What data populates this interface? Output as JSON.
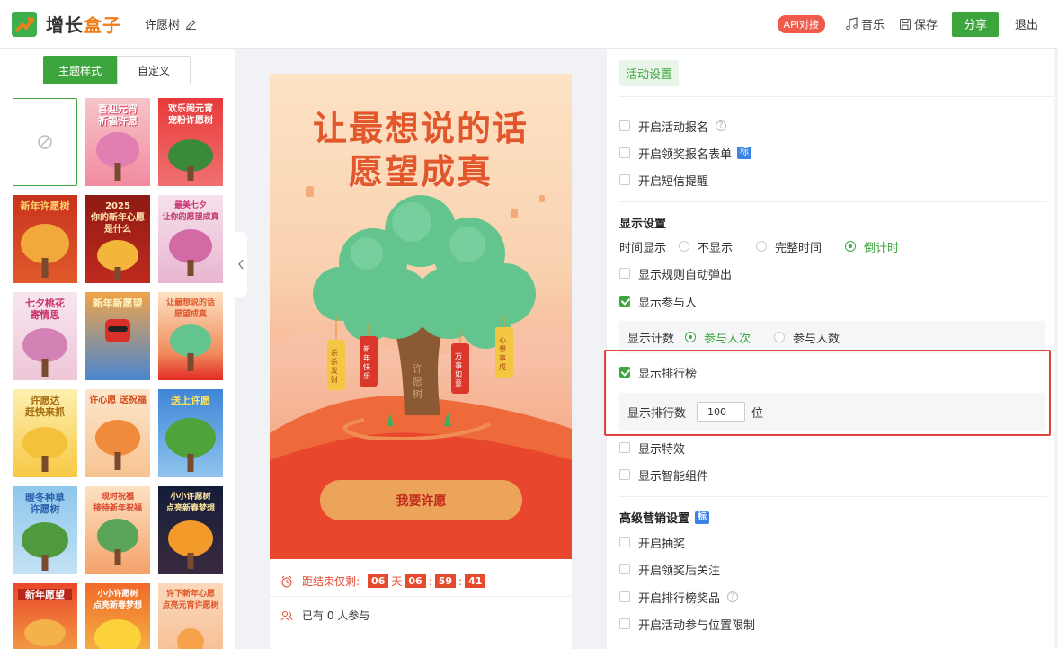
{
  "header": {
    "logo_text_part1": "增长",
    "logo_text_part2": "盒子",
    "doc_title": "许愿树",
    "api_badge": "API对接",
    "music_label": "音乐",
    "save_label": "保存",
    "share_label": "分享",
    "exit_label": "退出"
  },
  "left": {
    "tabs": [
      "主题样式",
      "自定义"
    ],
    "thumbnails": [
      {
        "caption": "",
        "name": "theme-thumb-none"
      },
      {
        "caption": "喜迎元宵\n祈福许愿",
        "name": "theme-thumb-lantern"
      },
      {
        "caption": "欢乐闹元宵\n宠粉许愿树",
        "name": "theme-thumb-party"
      },
      {
        "caption": "新年许愿树",
        "name": "theme-thumb-newyear"
      },
      {
        "caption": "2025\n你的新年心愿\n是什么",
        "name": "theme-thumb-2025"
      },
      {
        "caption": "最美七夕\n让你的愿望成真",
        "name": "theme-thumb-qixi"
      },
      {
        "caption": "七夕桃花\n寄情思",
        "name": "theme-thumb-peach"
      },
      {
        "caption": "新年新愿望",
        "name": "theme-thumb-snake"
      },
      {
        "caption": "让最想说的话\n愿望成真",
        "name": "theme-thumb-current"
      },
      {
        "caption": "许愿达\n赶快来抓",
        "name": "theme-thumb-yellow"
      },
      {
        "caption": "许心愿 送祝福",
        "name": "theme-thumb-orange"
      },
      {
        "caption": "送上许愿",
        "name": "theme-thumb-blue"
      },
      {
        "caption": "暖冬种草\n许愿树",
        "name": "theme-thumb-winter"
      },
      {
        "caption": "现时祝福\n接待新年祝福",
        "name": "theme-thumb-coin"
      },
      {
        "caption": "小小许愿树\n点亮新春梦想",
        "name": "theme-thumb-dark"
      },
      {
        "caption": "新年愿望",
        "name": "theme-thumb-door"
      },
      {
        "caption": "小小许愿树\n点亮新春梦想",
        "name": "theme-thumb-gold"
      },
      {
        "caption": "许下新年心愿\n点亮元宵许愿树",
        "name": "theme-thumb-lamp"
      }
    ]
  },
  "phone": {
    "title_line1": "让最想说的话",
    "title_line2": "愿望成真",
    "trunk_text": "许愿树",
    "tag1": "杀杀发财",
    "tag2": "新年快乐",
    "tag3": "万事如意",
    "tag4": "心想事成",
    "wish_button": "我要许愿",
    "countdown_prefix": "距结束仅剩:",
    "countdown_days": "06",
    "countdown_day_unit": "天",
    "countdown_hours": "06",
    "countdown_minutes": "59",
    "countdown_seconds": "41",
    "participants_text": "已有 0 人参与"
  },
  "right": {
    "tab_label": "活动设置",
    "opt_signup": "开启活动报名",
    "opt_prize_form": "开启领奖报名表单",
    "tag_label": "标",
    "opt_sms": "开启短信提醒",
    "display_title": "显示设置",
    "time_display_label": "时间显示",
    "time_opt_none": "不显示",
    "time_opt_full": "完整时间",
    "time_opt_countdown": "倒计时",
    "opt_rules_popup": "显示规则自动弹出",
    "opt_show_participants": "显示参与人",
    "count_label": "显示计数",
    "count_opt_times": "参与人次",
    "count_opt_people": "参与人数",
    "opt_ranking": "显示排行榜",
    "ranking_count_label": "显示排行数",
    "ranking_count_value": "100",
    "ranking_unit": "位",
    "opt_effects": "显示特效",
    "opt_smart": "显示智能组件",
    "advanced_title": "高级营销设置",
    "opt_lottery": "开启抽奖",
    "opt_follow": "开启领奖后关注",
    "opt_rank_prize": "开启排行榜奖品",
    "opt_location": "开启活动参与位置限制"
  },
  "colors": {
    "brand_green": "#3da53d",
    "accent_orange": "#f07d1a",
    "highlight_red": "#e1423a"
  }
}
